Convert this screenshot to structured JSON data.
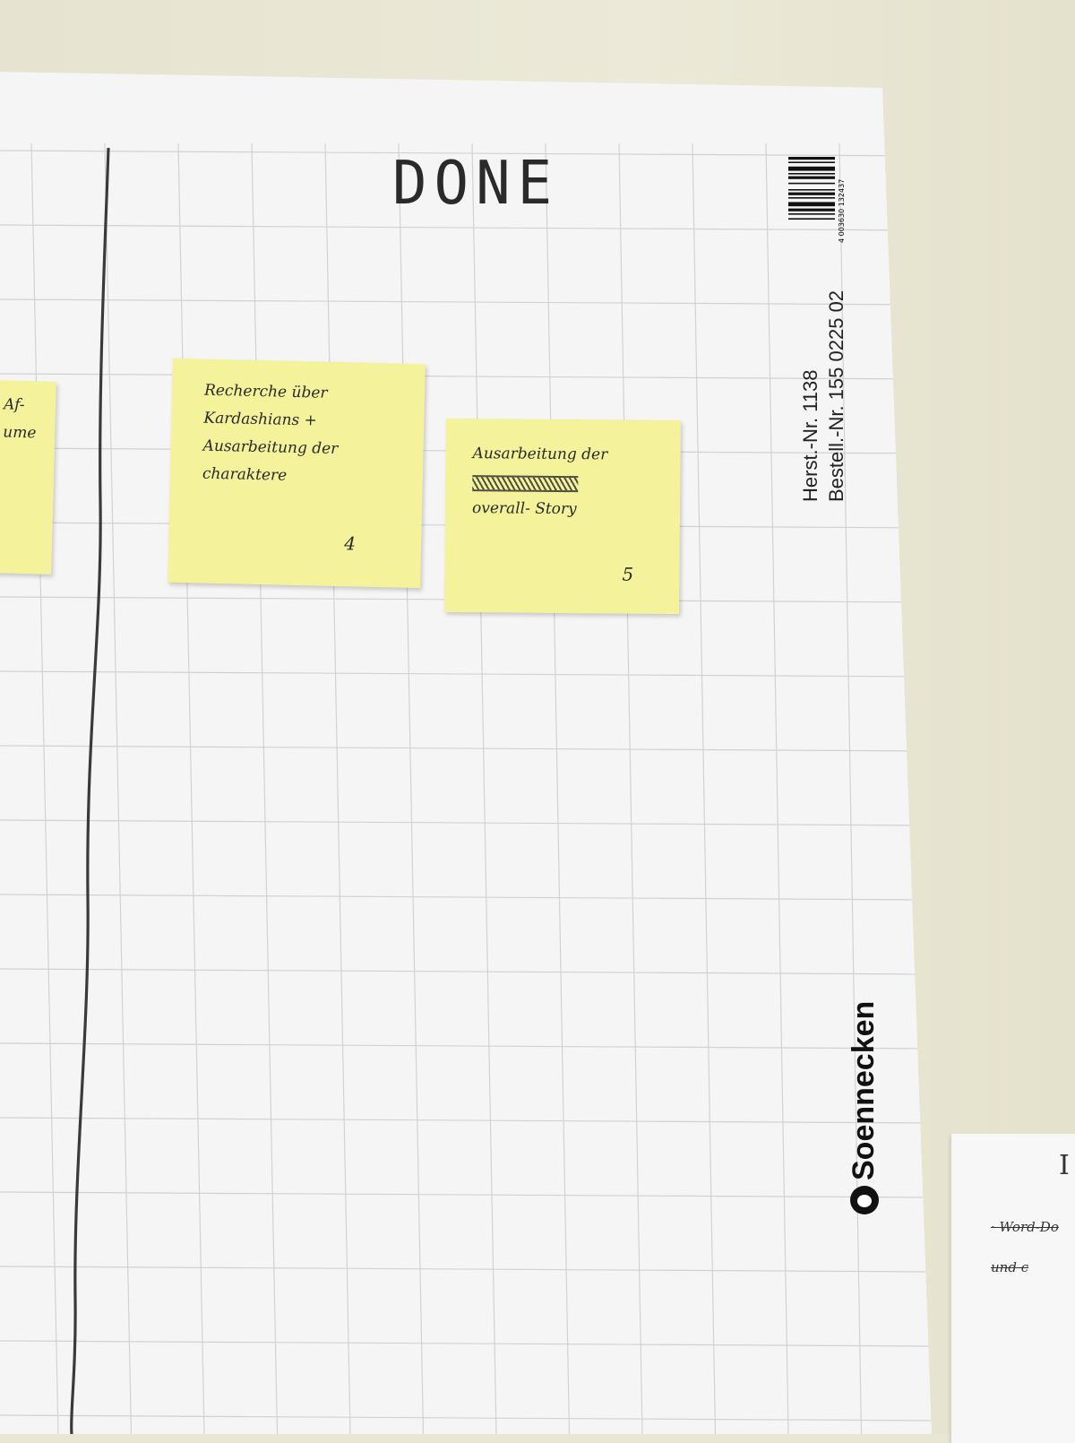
{
  "board": {
    "column_title": "DONE",
    "colors": {
      "wall": "#e9e6d4",
      "paper": "#f6f6f6",
      "grid": "#cfd2d6",
      "postit": "#f4f29a",
      "marker": "#2a2a2a"
    }
  },
  "left_note": {
    "lines": [
      "Af-",
      "ume"
    ]
  },
  "notes": [
    {
      "lines": [
        "Recherche über",
        "Kardashians +",
        "Ausarbeitung der",
        "charaktere"
      ],
      "number": "4"
    },
    {
      "lines": [
        "Ausarbeitung der",
        "overall- Story"
      ],
      "number": "5"
    }
  ],
  "paper_print": {
    "line1": "Herst.-Nr. 1138",
    "line2": "Bestell.-Nr. 155 0225 02",
    "barcode": "4 003630 132437",
    "brand": "Soennecken"
  },
  "side_paper": {
    "title": "I",
    "lines": [
      "· Word-Do",
      "und c"
    ]
  }
}
